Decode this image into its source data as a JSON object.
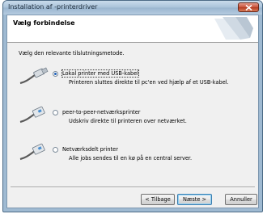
{
  "window": {
    "title": "Installation af -printerdriver"
  },
  "header": {
    "title": "Vælg forbindelse"
  },
  "instruction": "Vælg den relevante tilslutningsmetode.",
  "options": [
    {
      "label": "Lokal printer med USB-kabel",
      "description": "Printeren sluttes direkte til pc'en ved hjælp af et USB-kabel.",
      "selected": true,
      "icon": "usb-cable-icon"
    },
    {
      "label": "peer-to-peer-netværksprinter",
      "description": "Udskriv direkte til printeren over netværket.",
      "selected": false,
      "icon": "network-cable-icon"
    },
    {
      "label": "Netværksdelt printer",
      "description": "Alle jobs sendes til en kø på en central server.",
      "selected": false,
      "icon": "network-cable-icon"
    }
  ],
  "buttons": {
    "back": "< Tilbage",
    "next": "Næste >",
    "cancel": "Annuller"
  },
  "colors": {
    "radio_checked": "#1e5fb8",
    "close_button": "#c8523a",
    "titlebar": "#a9c2d9"
  }
}
